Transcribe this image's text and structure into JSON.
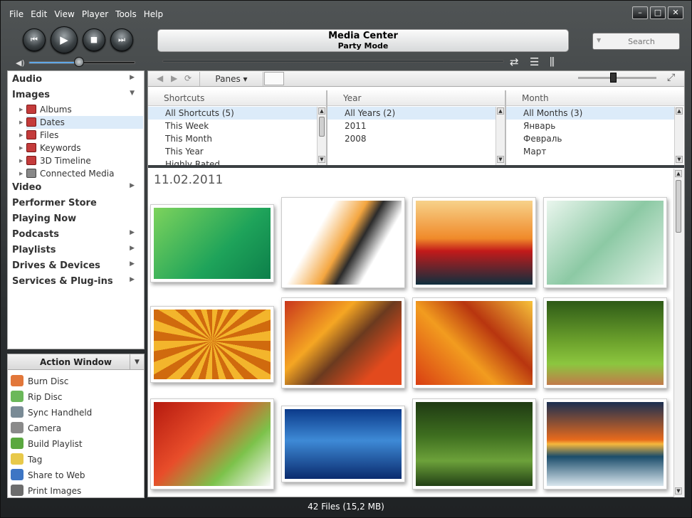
{
  "menu": [
    "File",
    "Edit",
    "View",
    "Player",
    "Tools",
    "Help"
  ],
  "window_controls": {
    "minimize": "–",
    "maximize": "□",
    "close": "✕"
  },
  "transport": {
    "prev": "⏮",
    "play": "▶",
    "stop": "■",
    "next": "⏭"
  },
  "display": {
    "title": "Media Center",
    "subtitle": "Party Mode"
  },
  "volume": 0.45,
  "search": {
    "placeholder": "Search"
  },
  "sidebar": {
    "items": [
      {
        "label": "Audio",
        "arrow": "▶"
      },
      {
        "label": "Images",
        "arrow": "▼"
      },
      {
        "label": "Video",
        "arrow": "▶"
      },
      {
        "label": "Performer Store",
        "arrow": ""
      },
      {
        "label": "Playing Now",
        "arrow": ""
      },
      {
        "label": "Podcasts",
        "arrow": "▶"
      },
      {
        "label": "Playlists",
        "arrow": "▶"
      },
      {
        "label": "Drives & Devices",
        "arrow": "▶"
      },
      {
        "label": "Services & Plug-ins",
        "arrow": "▶"
      }
    ],
    "images_children": [
      "Albums",
      "Dates",
      "Files",
      "Keywords",
      "3D Timeline",
      "Connected Media"
    ]
  },
  "action_window": {
    "title": "Action Window",
    "items": [
      {
        "label": "Burn Disc",
        "color": "#e2773a"
      },
      {
        "label": "Rip Disc",
        "color": "#6bb85a"
      },
      {
        "label": "Sync Handheld",
        "color": "#7a8b96"
      },
      {
        "label": "Camera",
        "color": "#8a8a8a"
      },
      {
        "label": "Build Playlist",
        "color": "#5aa83f"
      },
      {
        "label": "Tag",
        "color": "#e8c94a"
      },
      {
        "label": "Share to Web",
        "color": "#3d75c4"
      },
      {
        "label": "Print Images",
        "color": "#6d6d6d"
      }
    ]
  },
  "toolbar": {
    "panes_label": "Panes ▾"
  },
  "panes": {
    "shortcuts": {
      "header": "Shortcuts",
      "rows": [
        "All Shortcuts (5)",
        "This Week",
        "This Month",
        "This Year",
        "Highly Rated"
      ]
    },
    "year": {
      "header": "Year",
      "rows": [
        "All Years (2)",
        "2011",
        "2008"
      ]
    },
    "month": {
      "header": "Month",
      "rows": [
        "All Months (3)",
        "Январь",
        "Февраль",
        "Март"
      ]
    }
  },
  "grid": {
    "date_heading": "11.02.2011",
    "thumbnails": [
      {
        "name": "green-cartoon",
        "bg": "linear-gradient(135deg,#7dd35c,#1ea35a 60%,#0d7f4a)"
      },
      {
        "name": "abstract-ink",
        "bg": "linear-gradient(120deg,#ffffff 30%,#f4a640 50%,#2b2b2b 60%,#ffffff 75%)"
      },
      {
        "name": "red-flower",
        "bg": "linear-gradient(#f7d28a,#f08a2a 45%,#c21a1a 60%,#0e2f3e)"
      },
      {
        "name": "green-waves",
        "bg": "linear-gradient(135deg,#eaf6ee,#8cc9a4 50%,#e5f3ea)"
      },
      {
        "name": "orange-sunburst",
        "bg": "repeating-conic-gradient(from 0deg at 50% 45%,#f3b52c 0 10deg,#d06a0e 10deg 20deg)"
      },
      {
        "name": "autumn-leaves-cones",
        "bg": "linear-gradient(135deg,#c9361c,#f5a623 35%,#6b3a1f 55%,#e24a1d 80%)"
      },
      {
        "name": "maple-leaves",
        "bg": "linear-gradient(45deg,#d93e12,#f29c1f 40%,#b8350f 65%,#f7c23a)"
      },
      {
        "name": "tree-avenue",
        "bg": "linear-gradient(#2e5a17,#6ea42d 50%,#8cc63f 75%,#c27a4a)"
      },
      {
        "name": "red-maple-branch",
        "bg": "linear-gradient(135deg,#b51a0f,#e84d2a 40%,#7cc24a 70%,#fafafa)"
      },
      {
        "name": "blue-lines",
        "bg": "linear-gradient(#0b3a8a,#3e8ad6 45%,#0a2b6e)"
      },
      {
        "name": "mossy-tree",
        "bg": "linear-gradient(#1f3a13,#3e6e1f 40%,#6ca13a 70%,#224015)"
      },
      {
        "name": "sunset-sea",
        "bg": "linear-gradient(#1a2f52,#e76a1c 45%,#f6b73d 50%,#1b4d6b 65%,#d9e6ee)"
      }
    ]
  },
  "status": "42 Files (15,2 MB)"
}
